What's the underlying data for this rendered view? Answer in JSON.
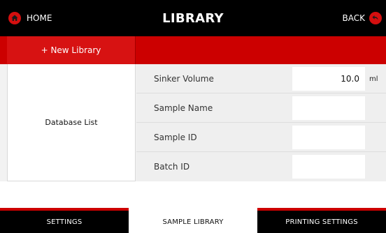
{
  "header": {
    "home_label": "HOME",
    "title": "LIBRARY",
    "back_label": "BACK"
  },
  "actions": {
    "new_library_label": "+ New Library"
  },
  "sidebar": {
    "database_list_label": "Database List"
  },
  "form": {
    "rows": [
      {
        "label": "Sinker Volume",
        "value": "10.0",
        "unit": "ml"
      },
      {
        "label": "Sample Name",
        "value": ""
      },
      {
        "label": "Sample ID",
        "value": ""
      },
      {
        "label": "Batch ID",
        "value": ""
      }
    ]
  },
  "tabs": [
    {
      "label": "SETTINGS",
      "active": false
    },
    {
      "label": "SAMPLE LIBRARY",
      "active": true
    },
    {
      "label": "PRINTING SETTINGS",
      "active": false
    }
  ],
  "colors": {
    "accent_red": "#cc0000",
    "header_bg": "#000000",
    "content_bg": "#f2f2f2"
  }
}
